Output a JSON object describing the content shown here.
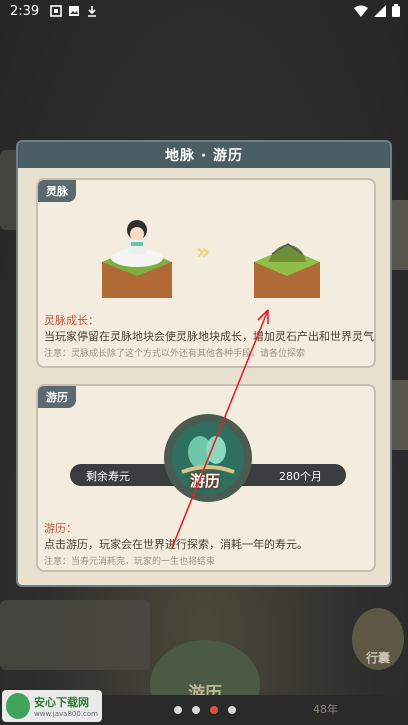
{
  "status_bar": {
    "time": "2:39"
  },
  "dialog": {
    "title": "地脉 · 游历",
    "card_spirit": {
      "tag": "灵脉",
      "caption_title": "灵脉成长：",
      "caption_desc": "当玩家停留在灵脉地块会使灵脉地块成长，增加灵石产出和世界灵气",
      "caption_note": "注意：灵脉成长除了这个方式以外还有其他各种手段，请各位探索"
    },
    "card_travel": {
      "tag": "游历",
      "lifespan_label": "剩余寿元",
      "lifespan_value": "280个月",
      "explore_label": "游历",
      "caption_title": "游历：",
      "caption_desc": "点击游历，玩家会在世界进行探索，消耗一年的寿元。",
      "caption_note": "注意：当寿元消耗完，玩家的一生也将结束"
    }
  },
  "background": {
    "right_button_label": "行囊",
    "center_button_label": "游历",
    "bottom_text_right": "48年"
  },
  "pager": {
    "count": 4,
    "active_index": 2
  },
  "watermark": {
    "title": "安心下载网",
    "url": "www.java800.com"
  },
  "colors": {
    "accent_red": "#e0523a",
    "header": "#4a5c64",
    "dialog_bg": "#e9e1d0",
    "caption_red": "#c0573d"
  }
}
